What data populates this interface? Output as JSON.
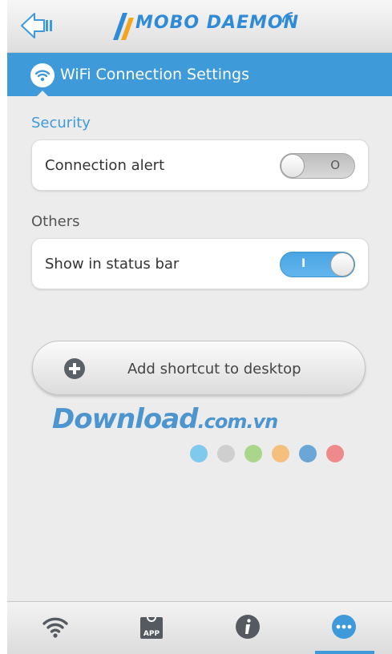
{
  "app": {
    "logo_text": "MOBO DAEMON"
  },
  "header": {
    "title": "WiFi Connection Settings"
  },
  "sections": [
    {
      "label": "Security",
      "items": [
        {
          "label": "Connection alert",
          "toggle_state": "off",
          "toggle_glyph": "O"
        }
      ]
    },
    {
      "label": "Others",
      "items": [
        {
          "label": "Show in status bar",
          "toggle_state": "on",
          "toggle_glyph": "I"
        }
      ]
    }
  ],
  "shortcut": {
    "label": "Add shortcut to desktop"
  },
  "watermark": {
    "text_main": "Download",
    "text_domain": ".com.vn",
    "dot_colors": [
      "#7fc9ee",
      "#cfcfcf",
      "#a9d68a",
      "#f5c07d",
      "#6aa6d6",
      "#ef8a8c"
    ]
  },
  "bottom_nav": {
    "tabs": [
      {
        "icon": "wifi-icon"
      },
      {
        "icon": "app-store-icon",
        "badge": "APP"
      },
      {
        "icon": "info-icon"
      },
      {
        "icon": "more-icon"
      }
    ],
    "active_index": 3
  },
  "colors": {
    "accent": "#3f9ad9",
    "background": "#ececec"
  }
}
